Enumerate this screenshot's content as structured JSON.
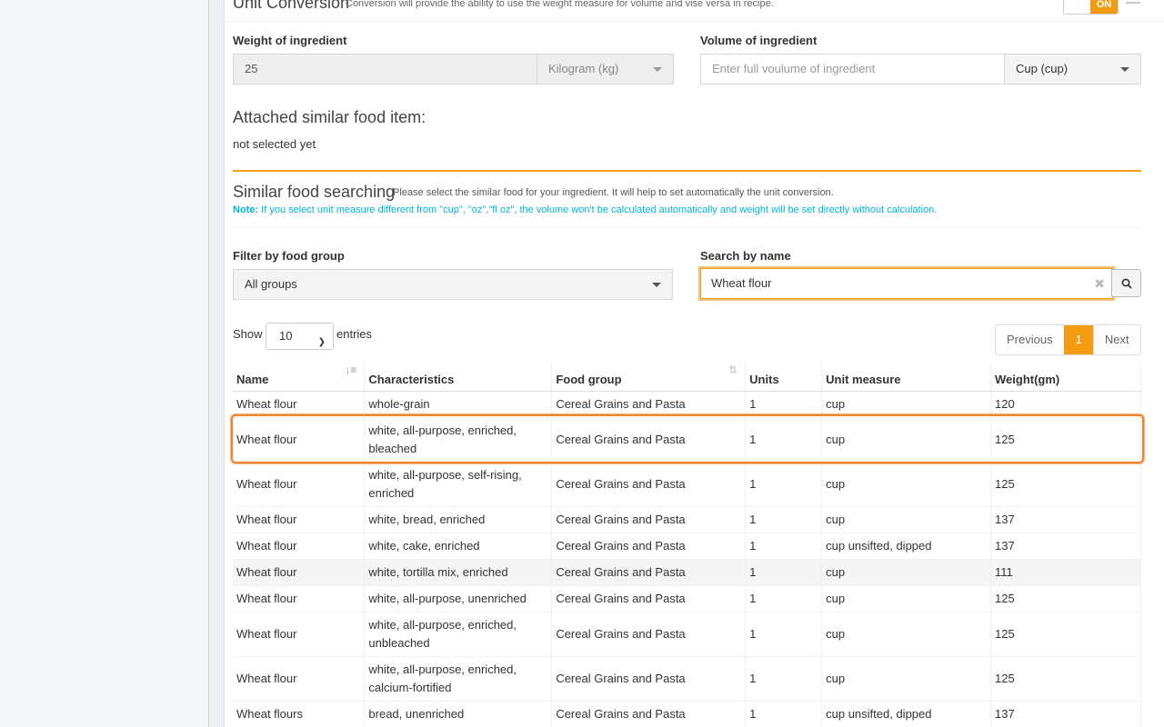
{
  "unit_conversion": {
    "title": "Unit Conversion",
    "subtitle": "Conversion will provide the ability to use the weight measure for volume and vise versa in recipe.",
    "toggle_label": "ON"
  },
  "weight": {
    "label": "Weight of ingredient",
    "value": "25",
    "unit": "Kilogram (kg)"
  },
  "volume": {
    "label": "Volume of ingredient",
    "placeholder": "Enter full voulume of ingredient",
    "unit": "Cup (cup)"
  },
  "attached": {
    "title": "Attached similar food item:",
    "value": "not selected yet"
  },
  "similar": {
    "title": "Similar food searching",
    "hint": "Please select the similar food for your ingredient. It will help to set automatically the unit conversion.",
    "note_label": "Note:",
    "note_text": "If you select unit measure different from \"cup\", \"oz\",\"fl oz\", the volume won't be calculated automatically and weight will be set directly without calculation."
  },
  "filter": {
    "label": "Filter by food group",
    "value": "All groups"
  },
  "search": {
    "label": "Search by name",
    "value": "Wheat flour"
  },
  "entries": {
    "show": "Show",
    "value": "10",
    "suffix": "entries"
  },
  "pager": {
    "previous": "Previous",
    "current": "1",
    "next": "Next"
  },
  "table": {
    "columns": [
      "Name",
      "Characteristics",
      "Food group",
      "Units",
      "Unit measure",
      "Weight(gm)"
    ],
    "rows": [
      [
        "Wheat flour",
        "whole-grain",
        "Cereal Grains and Pasta",
        "1",
        "cup",
        "120"
      ],
      [
        "Wheat flour",
        "white, all-purpose, enriched, bleached",
        "Cereal Grains and Pasta",
        "1",
        "cup",
        "125"
      ],
      [
        "Wheat flour",
        "white, all-purpose, self-rising, enriched",
        "Cereal Grains and Pasta",
        "1",
        "cup",
        "125"
      ],
      [
        "Wheat flour",
        "white, bread, enriched",
        "Cereal Grains and Pasta",
        "1",
        "cup",
        "137"
      ],
      [
        "Wheat flour",
        "white, cake, enriched",
        "Cereal Grains and Pasta",
        "1",
        "cup unsifted, dipped",
        "137"
      ],
      [
        "Wheat flour",
        "white, tortilla mix, enriched",
        "Cereal Grains and Pasta",
        "1",
        "cup",
        "111"
      ],
      [
        "Wheat flour",
        "white, all-purpose, unenriched",
        "Cereal Grains and Pasta",
        "1",
        "cup",
        "125"
      ],
      [
        "Wheat flour",
        "white, all-purpose, enriched, unbleached",
        "Cereal Grains and Pasta",
        "1",
        "cup",
        "125"
      ],
      [
        "Wheat flour",
        "white, all-purpose, enriched, calcium-fortified",
        "Cereal Grains and Pasta",
        "1",
        "cup",
        "125"
      ],
      [
        "Wheat flours",
        "bread, unenriched",
        "Cereal Grains and Pasta",
        "1",
        "cup unsifted, dipped",
        "137"
      ]
    ]
  },
  "colors": {
    "accent": "#f39c12",
    "note": "#00b5d8"
  }
}
